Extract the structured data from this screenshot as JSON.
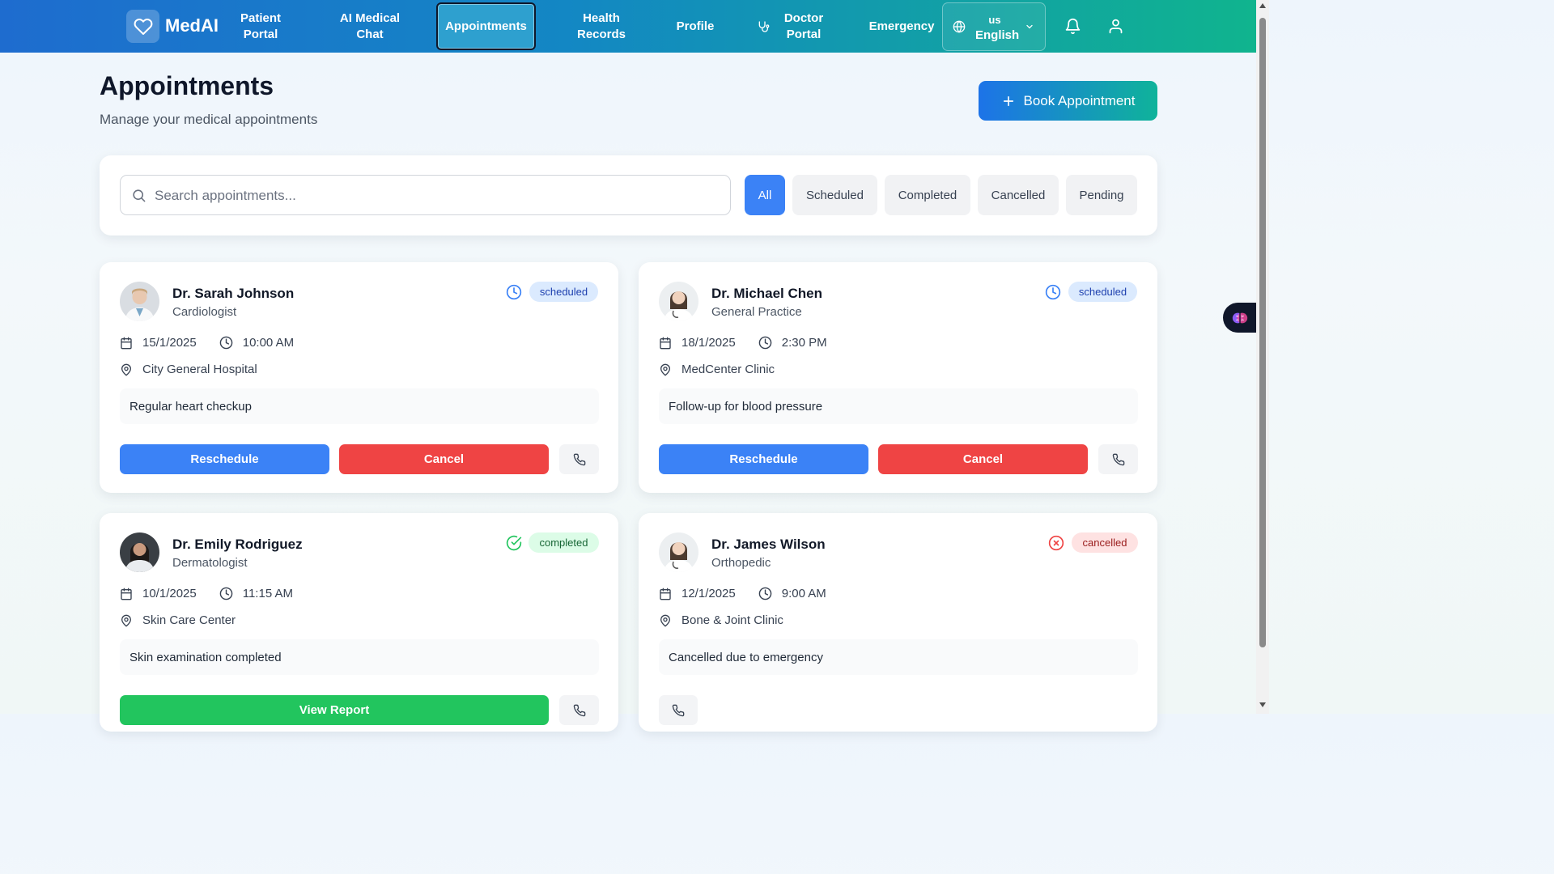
{
  "nav": {
    "brand": "MedAI",
    "items": [
      {
        "label": "Patient Portal",
        "lines": [
          "Patient",
          "Portal"
        ]
      },
      {
        "label": "AI Medical Chat",
        "lines": [
          "AI Medical",
          "Chat"
        ]
      },
      {
        "label": "Appointments",
        "lines": [
          "Appointments"
        ],
        "active": true
      },
      {
        "label": "Health Records",
        "lines": [
          "Health",
          "Records"
        ]
      },
      {
        "label": "Profile",
        "lines": [
          "Profile"
        ]
      },
      {
        "label": "Doctor Portal",
        "lines": [
          "Doctor",
          "Portal"
        ]
      },
      {
        "label": "Emergency",
        "lines": [
          "Emergency"
        ]
      }
    ],
    "language": {
      "code": "us",
      "label": "English"
    }
  },
  "header": {
    "title": "Appointments",
    "subtitle": "Manage your medical appointments",
    "book_button": "Book Appointment"
  },
  "filters": {
    "search_placeholder": "Search appointments...",
    "tabs": [
      "All",
      "Scheduled",
      "Completed",
      "Cancelled",
      "Pending"
    ],
    "active": "All"
  },
  "appointments": [
    {
      "doctor": "Dr. Sarah Johnson",
      "specialty": "Cardiologist",
      "status": "scheduled",
      "date": "15/1/2025",
      "time": "10:00 AM",
      "location": "City General Hospital",
      "notes": "Regular heart checkup",
      "actions": [
        "Reschedule",
        "Cancel"
      ]
    },
    {
      "doctor": "Dr. Michael Chen",
      "specialty": "General Practice",
      "status": "scheduled",
      "date": "18/1/2025",
      "time": "2:30 PM",
      "location": "MedCenter Clinic",
      "notes": "Follow-up for blood pressure",
      "actions": [
        "Reschedule",
        "Cancel"
      ]
    },
    {
      "doctor": "Dr. Emily Rodriguez",
      "specialty": "Dermatologist",
      "status": "completed",
      "date": "10/1/2025",
      "time": "11:15 AM",
      "location": "Skin Care Center",
      "notes": "Skin examination completed",
      "actions": [
        "View Report"
      ]
    },
    {
      "doctor": "Dr. James Wilson",
      "specialty": "Orthopedic",
      "status": "cancelled",
      "date": "12/1/2025",
      "time": "9:00 AM",
      "location": "Bone & Joint Clinic",
      "notes": "Cancelled due to emergency",
      "actions": []
    }
  ],
  "colors": {
    "primary": "#3b82f6",
    "danger": "#ef4444",
    "success": "#22c55e",
    "nav_gradient_start": "#1e6ccf",
    "nav_gradient_end": "#10b48e"
  }
}
